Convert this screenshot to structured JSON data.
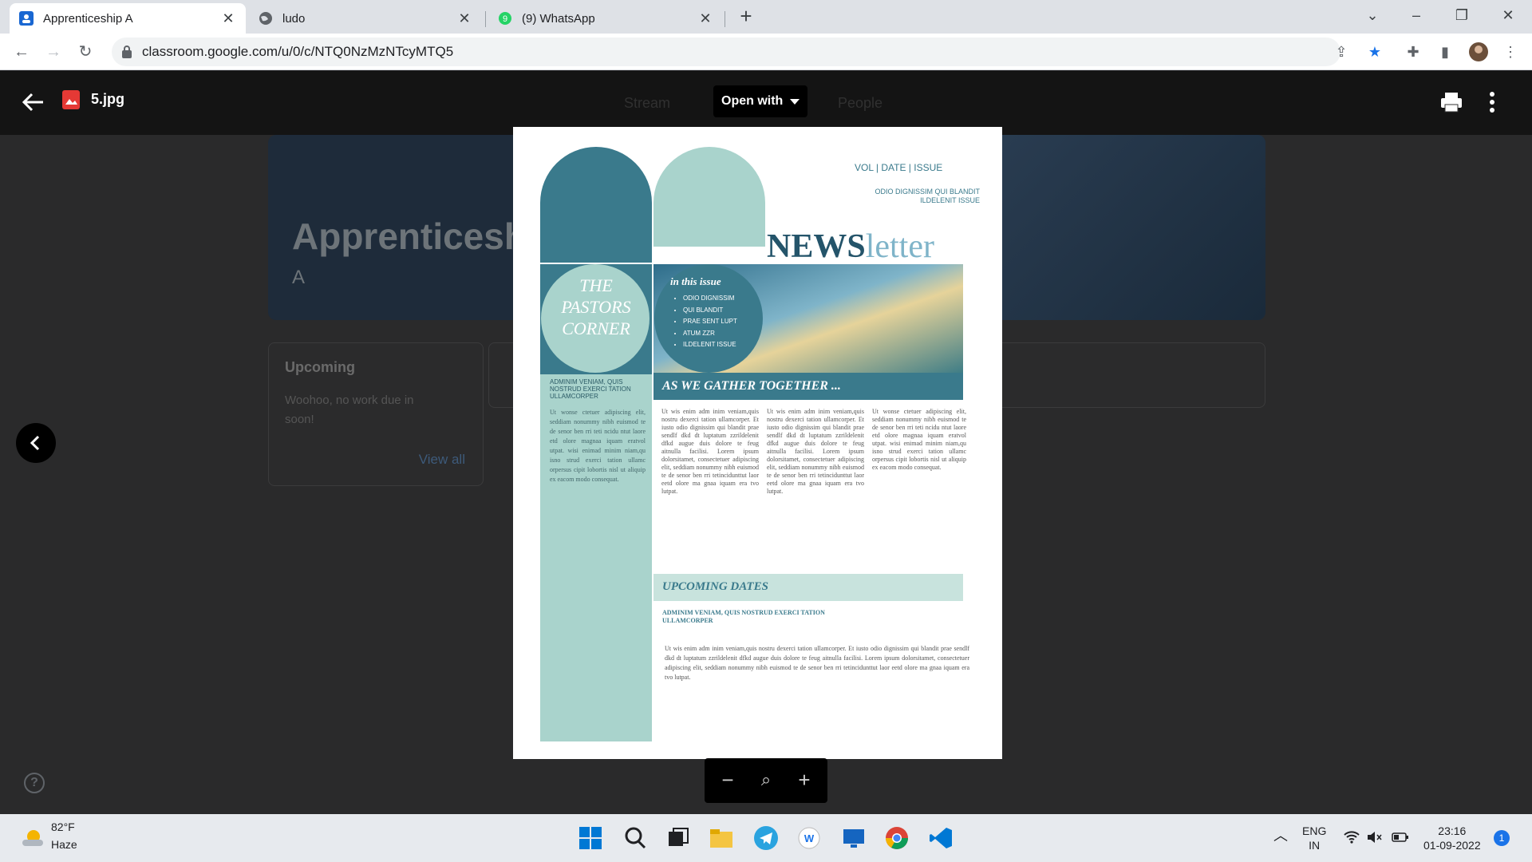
{
  "browser": {
    "tabs": [
      {
        "title": "Apprenticeship A",
        "active": true,
        "icon": "classroom-icon"
      },
      {
        "title": "ludo",
        "active": false,
        "icon": "globe-icon"
      },
      {
        "title": "(9) WhatsApp",
        "active": false,
        "icon": "whatsapp-icon"
      }
    ],
    "url": "classroom.google.com/u/0/c/NTQ0NzMzNTcyMTQ5"
  },
  "classroom": {
    "class_title": "Apprenticesh",
    "class_section": "A",
    "nav": [
      "Stream",
      "People"
    ],
    "upcoming_title": "Upcoming",
    "upcoming_text": "Woohoo, no work due in soon!",
    "view_all": "View all"
  },
  "viewer": {
    "file_name": "5.jpg",
    "open_with": "Open with"
  },
  "newsletter": {
    "header_meta": "VOL  |  DATE  |  ISSUE",
    "header_sub": "ODIO DIGNISSIM QUI BLANDIT ILDELENIT ISSUE",
    "title_bold": "NEWS",
    "title_light": "letter",
    "pastors_corner": "THE PASTORS CORNER",
    "in_this_issue": "in this issue",
    "issue_items": [
      "ODIO DIGNISSIM",
      "QUI BLANDIT",
      "PRAE SENT LUPT",
      "ATUM ZZR",
      "ILDELENIT ISSUE"
    ],
    "left_caption": "ADMINIM VENIAM, QUIS NOSTRUD EXERCI TATION ULLAMCORPER",
    "gather_heading": "AS WE GATHER TOGETHER ...",
    "upcoming_heading": "UPCOMING DATES",
    "upcoming_sub": "ADMINIM VENIAM, QUIS NOSTRUD EXERCI TATION ULLAMCORPER",
    "lorem": "Ut wis enim adm inim veniam,quis nostru dexerci tation ullamcorper. Et iusto odio dignissim qui blandit prae sendlf dkd dt luptatum zzrildelenit dfkd augue duis dolore te feug aitnulla facilisi. Lorem ipsum dolorsitamet, consectetuer adipiscing elit, seddiam nonummy nibh euismod te de senor ben rri tetincidunttut laor eetd olore ma gnaa iquam era tvo lutpat.",
    "lorem_short": "Ut wonse ctetuer adipiscing elit, seddiam nonummy nibh euismod te de senor ben rri teti ncidu ntut laore etd olore magnaa iquam eratvol utpat. wisi enimad minim niam,qu isno strud exerci tation ullamc orpersus cipit lobortis nisl ut aliquip ex eacom modo consequat."
  },
  "taskbar": {
    "temperature": "82°F",
    "weather": "Haze",
    "lang": "ENG",
    "region": "IN",
    "time": "23:16",
    "date": "01-09-2022",
    "notifications": "1"
  }
}
